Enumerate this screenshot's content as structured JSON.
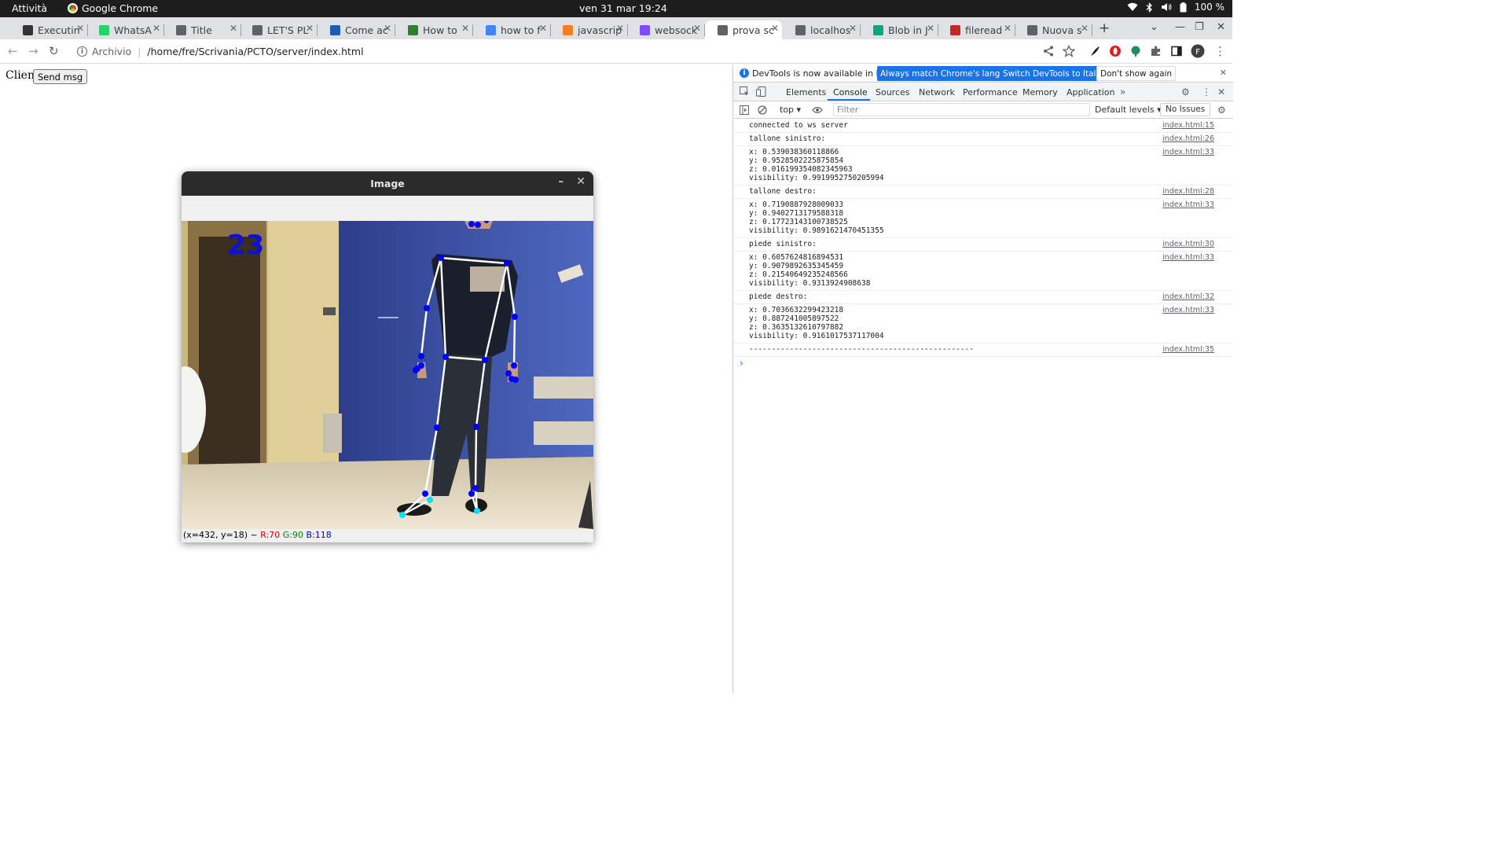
{
  "topbar": {
    "activities": "Attività",
    "app_name": "Google Chrome",
    "clock": "ven 31 mar  19:24",
    "battery": "100 %"
  },
  "tabs": [
    {
      "label": "Executin",
      "icon_color": "#333333",
      "active": false
    },
    {
      "label": "WhatsA",
      "icon_color": "#25d366",
      "active": false
    },
    {
      "label": "Title",
      "icon_color": "#5f6368",
      "active": false
    },
    {
      "label": "LET'S PL",
      "icon_color": "#5f6368",
      "active": false
    },
    {
      "label": "Come ac",
      "icon_color": "#1a5fb4",
      "active": false
    },
    {
      "label": "How to",
      "icon_color": "#2e7d32",
      "active": false
    },
    {
      "label": "how to f",
      "icon_color": "#4285f4",
      "active": false
    },
    {
      "label": "javascrip",
      "icon_color": "#f48024",
      "active": false
    },
    {
      "label": "websock",
      "icon_color": "#7c4dff",
      "active": false
    },
    {
      "label": "prova sc",
      "icon_color": "#5f6368",
      "active": true
    },
    {
      "label": "localhos",
      "icon_color": "#5f6368",
      "active": false
    },
    {
      "label": "Blob in J",
      "icon_color": "#10a37f",
      "active": false
    },
    {
      "label": "fileread",
      "icon_color": "#c62828",
      "active": false
    },
    {
      "label": "Nuova s",
      "icon_color": "#5f6368",
      "active": false
    }
  ],
  "omnibox": {
    "scheme_label": "Archivio",
    "url": "/home/fre/Scrivania/PCTO/server/index.html"
  },
  "profile_initial": "F",
  "page": {
    "client_label": "Client",
    "send_button": "Send msg"
  },
  "cv_window": {
    "title": "Image",
    "frame_counter": "23",
    "status_prefix": "(x=432, y=18) ~ ",
    "r": "R:70",
    "g": "G:90",
    "b": "B:118"
  },
  "devtools": {
    "info_message": "DevTools is now available in Italian!",
    "btn_match": "Always match Chrome's language",
    "btn_switch": "Switch DevTools to Italian",
    "btn_dont_show": "Don't show again",
    "tabs": [
      "Elements",
      "Console",
      "Sources",
      "Network",
      "Performance",
      "Memory",
      "Application"
    ],
    "context": "top ▾",
    "filter_placeholder": "Filter",
    "levels": "Default levels ▾",
    "issues": "No Issues"
  },
  "console": [
    {
      "text": "connected to ws server",
      "src": "index.html:15"
    },
    {
      "text": "tallone sinistro:",
      "src": "index.html:26"
    },
    {
      "text": "x: 0.539038360118866\ny: 0.9528502225875854\nz: 0.016199354082345963\nvisibility: 0.9919952750205994",
      "src": "index.html:33"
    },
    {
      "text": "tallone destro:",
      "src": "index.html:28"
    },
    {
      "text": "x: 0.7190887928009033\ny: 0.9402713179588318\nz: 0.17723143100738525\nvisibility: 0.9891621470451355",
      "src": "index.html:33"
    },
    {
      "text": "piede sinistro:",
      "src": "index.html:30"
    },
    {
      "text": "x: 0.6057624816894531\ny: 0.9079892635345459\nz: 0.21540649235248566\nvisibility: 0.9313924908638",
      "src": "index.html:33"
    },
    {
      "text": "piede destro:",
      "src": "index.html:32"
    },
    {
      "text": "x: 0.7036632299423218\ny: 0.887241005897522\nz: 0.3635132610797882\nvisibility: 0.9161017537117004",
      "src": "index.html:33"
    },
    {
      "text": "--------------------------------------------------",
      "src": "index.html:35"
    }
  ],
  "prompt_symbol": "›"
}
